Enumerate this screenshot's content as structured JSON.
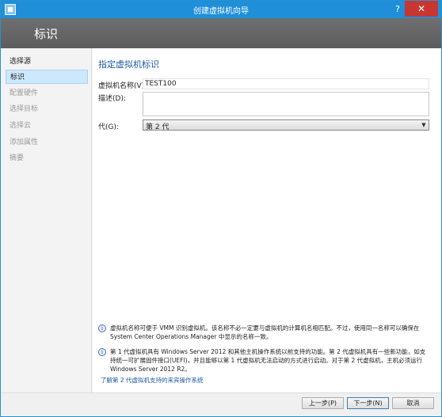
{
  "window": {
    "title": "创建虚拟机向导",
    "help": "?",
    "close": "✕"
  },
  "banner": {
    "title": "标识"
  },
  "steps": [
    {
      "label": "选择源",
      "state": "done"
    },
    {
      "label": "标识",
      "state": "active"
    },
    {
      "label": "配置硬件",
      "state": "pending"
    },
    {
      "label": "选择目标",
      "state": "pending"
    },
    {
      "label": "选择云",
      "state": "pending"
    },
    {
      "label": "添加属性",
      "state": "pending"
    },
    {
      "label": "摘要",
      "state": "pending"
    }
  ],
  "content": {
    "section_title": "指定虚拟机标识",
    "name_label": "虚拟机名称(V):",
    "name_value": "TEST100",
    "description_label": "描述(D):",
    "description_value": "",
    "generation_label": "代(G):",
    "generation_value": "第 2 代"
  },
  "info": [
    {
      "icon": "info-icon",
      "text": "虚拟机名称可便于 VMM 识别虚拟机。该名称不必一定要与虚拟机的计算机名相匹配。不过，使用同一名称可以确保在 System Center Operations Manager 中显示的名称一致。"
    },
    {
      "icon": "info-icon",
      "text": "第 1 代虚拟机具有 Windows Server 2012 和其他主机操作系统以前支持的功能。第 2 代虚拟机具有一些新功能，如支持统一可扩展固件接口(UEFI)，并且能够以第 1 代虚拟机无法启动的方式进行启动。对于第 2 代虚拟机，主机必须运行 Windows Server 2012 R2。"
    }
  ],
  "learn_link": "了解第 2 代虚拟机支持的来宾操作系统",
  "buttons": {
    "previous": "上一步(P)",
    "next": "下一步(N)",
    "cancel": "取消"
  }
}
